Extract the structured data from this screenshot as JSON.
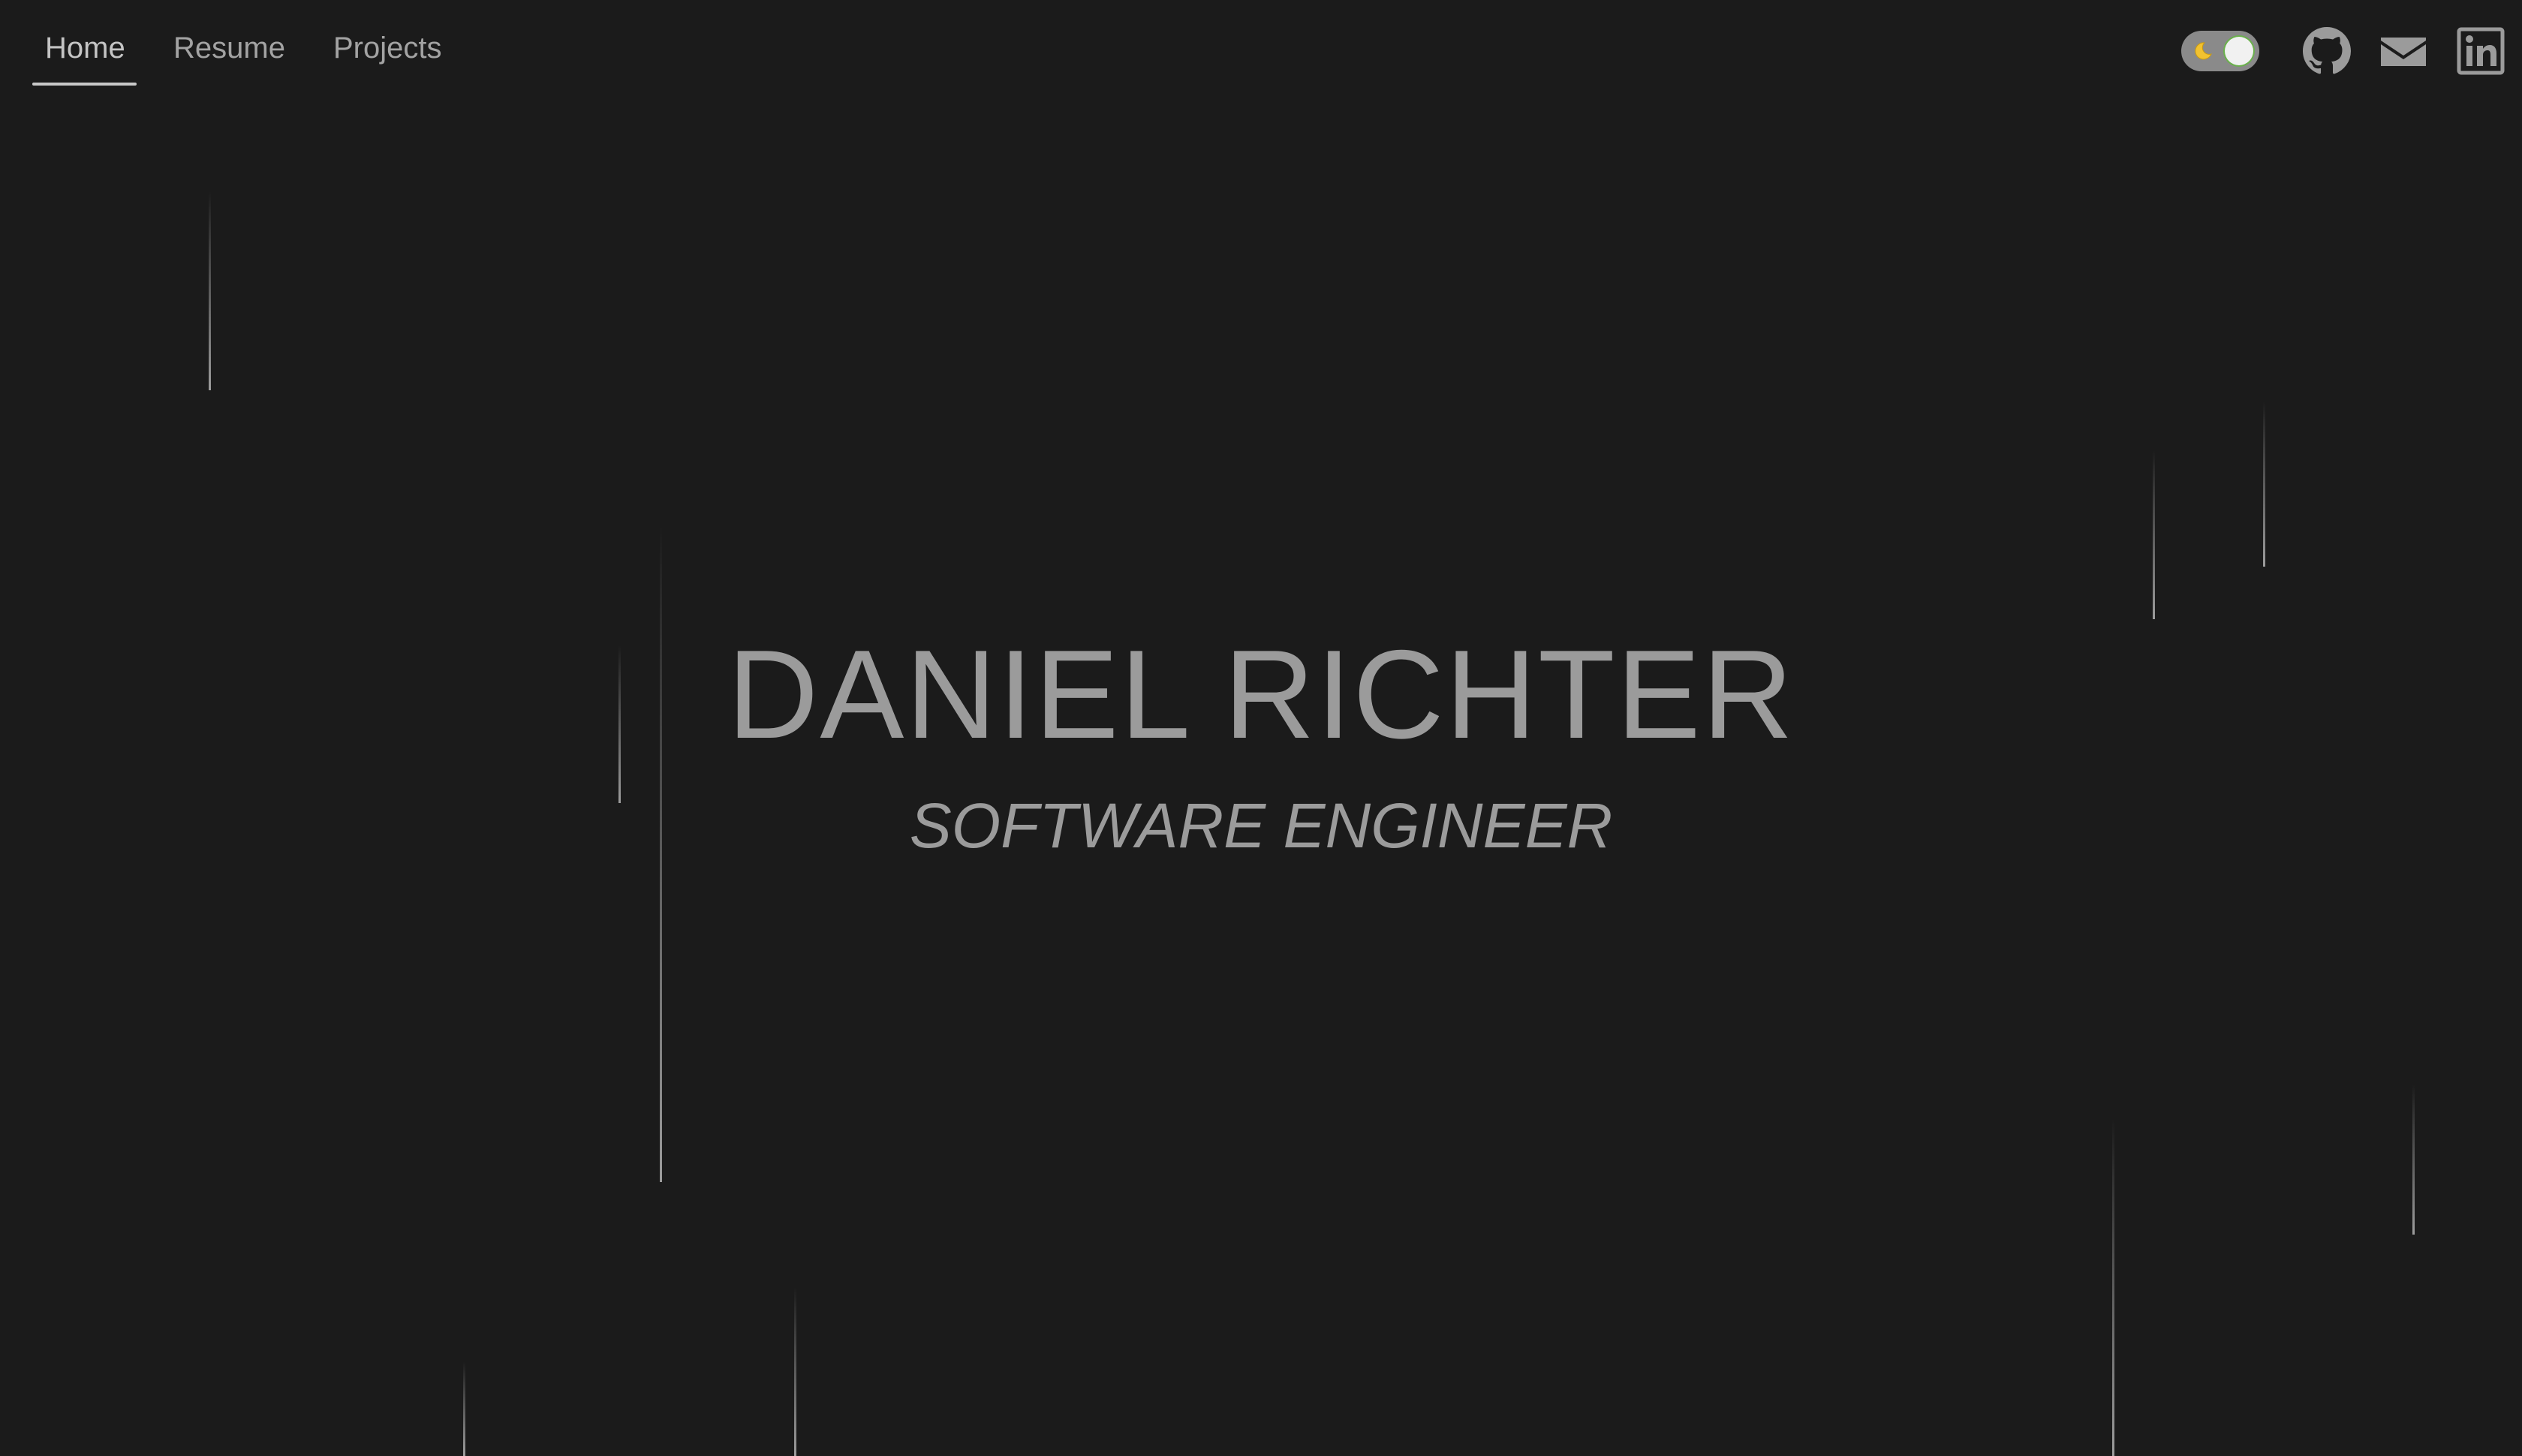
{
  "nav": {
    "items": [
      {
        "label": "Home",
        "active": true
      },
      {
        "label": "Resume",
        "active": false
      },
      {
        "label": "Projects",
        "active": false
      }
    ]
  },
  "toolbar": {
    "theme_toggle": {
      "state": "dark",
      "icon": "moon-icon"
    },
    "links": [
      {
        "icon": "github-icon"
      },
      {
        "icon": "mail-icon"
      },
      {
        "icon": "linkedin-icon"
      }
    ]
  },
  "hero": {
    "name": "DANIEL RICHTER",
    "title": "SOFTWARE ENGINEER"
  },
  "colors": {
    "background": "#1b1b1b",
    "text": "#9b9b9b",
    "nav_text": "#a3a3a3",
    "toggle_track": "#8a8a8a",
    "toggle_knob": "#f1f1f1"
  }
}
